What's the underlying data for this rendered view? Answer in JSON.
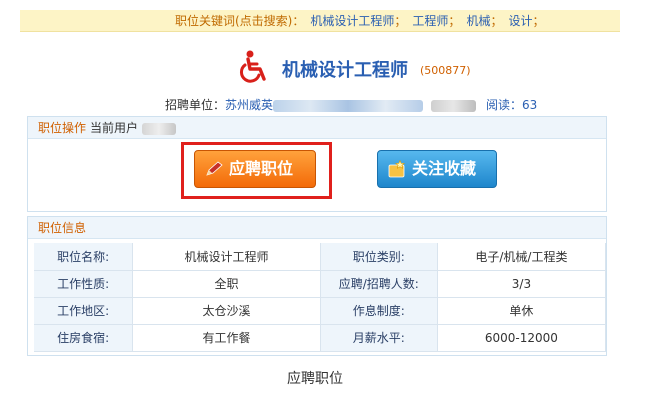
{
  "keyword_bar": {
    "label": "职位关键词(点击搜索)：",
    "keywords": [
      "机械设计工程师",
      "工程师",
      "机械",
      "设计"
    ],
    "separator": "；"
  },
  "job": {
    "title": "机械设计工程师",
    "code": "(500877)",
    "company_label": "招聘单位：",
    "company_name_prefix": "苏州威英",
    "read_label": "阅读：",
    "read_count": "63"
  },
  "operation_panel": {
    "title": "职位操作",
    "current_user_label": "当前用户",
    "apply_button": "应聘职位",
    "favorite_button": "关注收藏"
  },
  "info_panel": {
    "title": "职位信息",
    "rows": [
      {
        "label1": "职位名称:",
        "value1": "机械设计工程师",
        "label2": "职位类别:",
        "value2": "电子/机械/工程类"
      },
      {
        "label1": "工作性质:",
        "value1": "全职",
        "label2": "应聘/招聘人数:",
        "value2": "3/3"
      },
      {
        "label1": "工作地区:",
        "value1": "太仓沙溪",
        "label2": "作息制度:",
        "value2": "单休"
      },
      {
        "label1": "住房食宿:",
        "value1": "有工作餐",
        "label2": "月薪水平:",
        "value2": "6000-12000"
      }
    ]
  },
  "caption": "应聘职位",
  "colors": {
    "accent_orange": "#f36a08",
    "highlight_red": "#e0201c",
    "link_blue": "#2a5fb2",
    "favorite_blue": "#1e86cc"
  }
}
